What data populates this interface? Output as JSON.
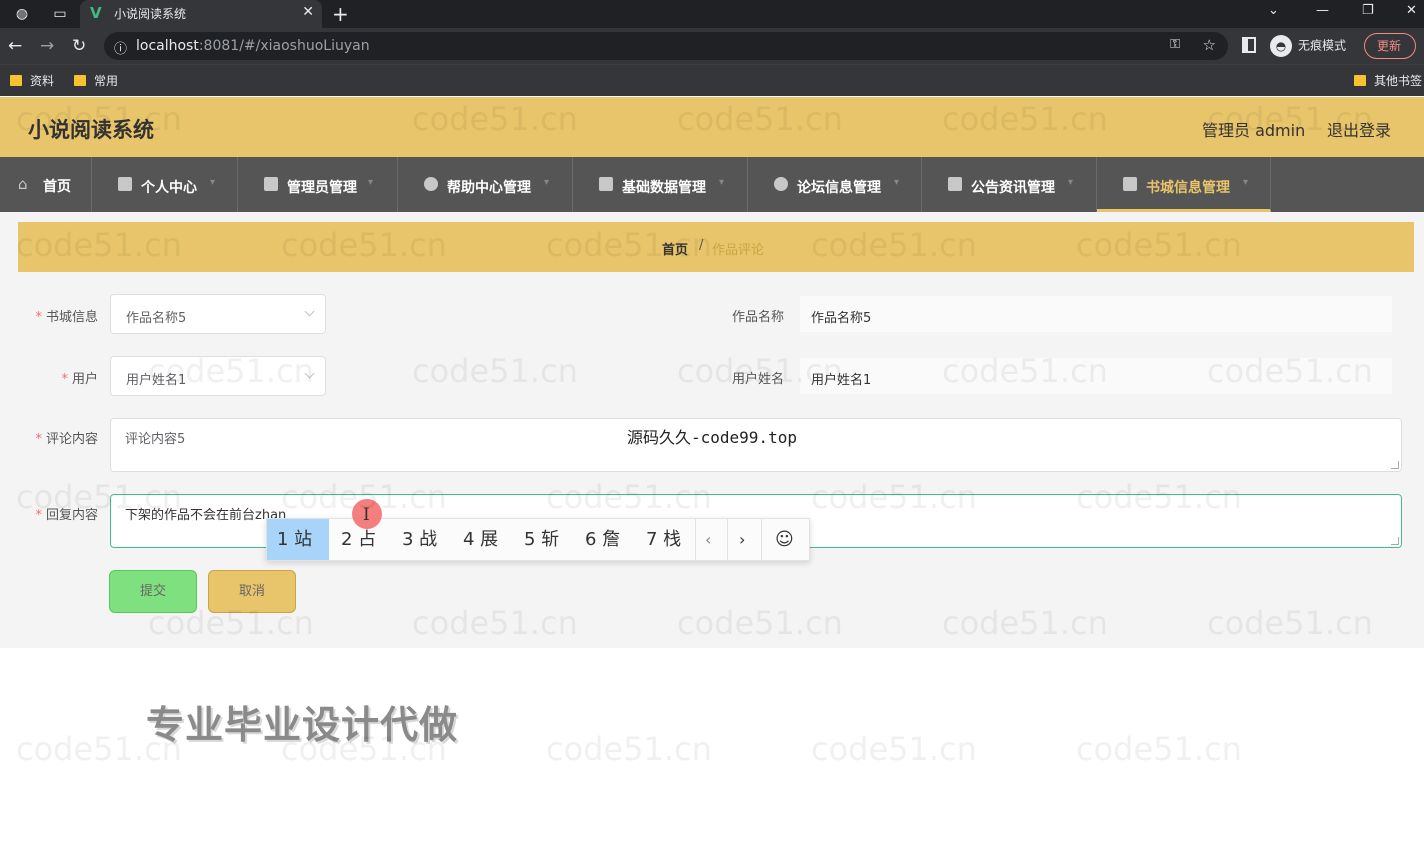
{
  "browser": {
    "tab_title": "小说阅读系统",
    "url_host": "localhost",
    "url_rest": ":8081/#/xiaoshuoLiuyan",
    "incognito_label": "无痕模式",
    "update_label": "更新",
    "bookmarks": [
      "资料",
      "常用",
      "其他书签"
    ]
  },
  "app": {
    "title": "小说阅读系统",
    "admin_label": "管理员 admin",
    "logout_label": "退出登录"
  },
  "nav": [
    {
      "label": "首页"
    },
    {
      "label": "个人中心"
    },
    {
      "label": "管理员管理"
    },
    {
      "label": "帮助中心管理"
    },
    {
      "label": "基础数据管理"
    },
    {
      "label": "论坛信息管理"
    },
    {
      "label": "公告资讯管理"
    },
    {
      "label": "书城信息管理"
    }
  ],
  "breadcrumb": {
    "home": "首页",
    "separator": "/",
    "current": "作品评论"
  },
  "form": {
    "book_label": "书城信息",
    "book_value": "作品名称5",
    "work_name_label": "作品名称",
    "work_name_value": "作品名称5",
    "user_label": "用户",
    "user_value": "用户姓名1",
    "user_name_label": "用户姓名",
    "user_name_value": "用户姓名1",
    "comment_label": "评论内容",
    "comment_value": "评论内容5",
    "reply_label": "回复内容",
    "reply_value": "下架的作品不会在前台zhan",
    "submit_label": "提交",
    "cancel_label": "取消"
  },
  "ime_candidates": [
    "1 站",
    "2 占",
    "3 战",
    "4 展",
    "5 斩",
    "6 詹",
    "7 栈"
  ],
  "overlay_text": "源码久久-code99.top",
  "promo_text": "专业毕业设计代做",
  "watermark": "code51.cn",
  "colors": {
    "header": "#e8c56a",
    "nav": "#555555",
    "submit": "#7ee07e",
    "ime_selected": "#a8d4fa"
  }
}
